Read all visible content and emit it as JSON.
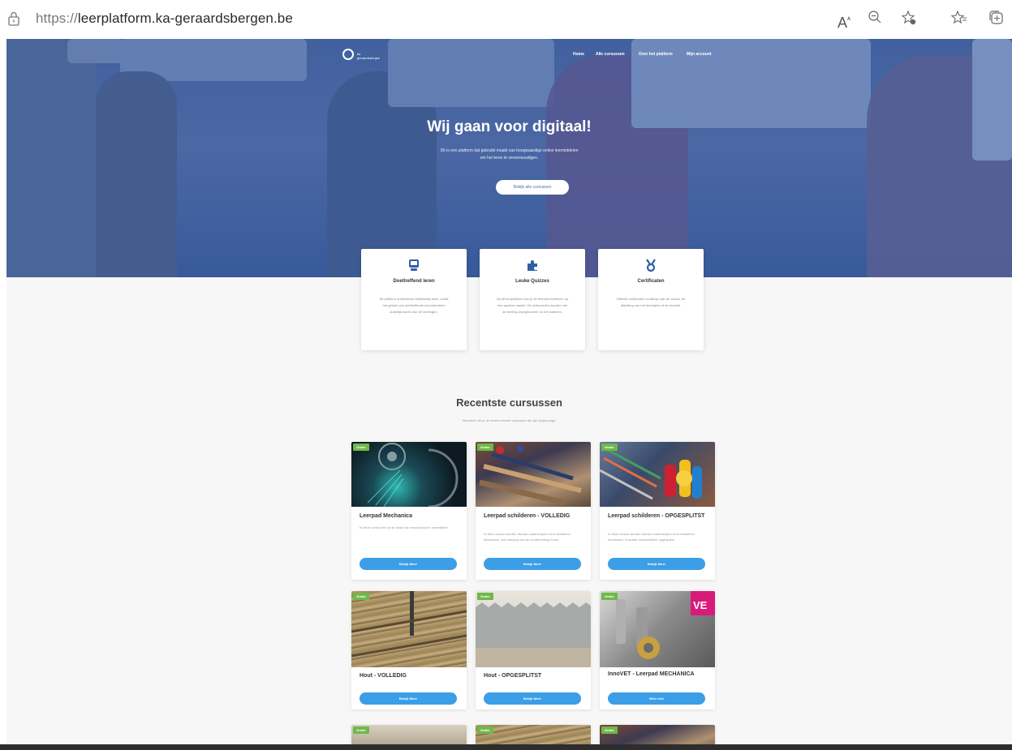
{
  "browser": {
    "url_prefix": "https://",
    "url_host": "leerplatform.ka-geraardsbergen.be",
    "icons": [
      "read-aloud-icon",
      "zoom-icon",
      "favorite-add-icon",
      "favorites-icon",
      "collections-icon"
    ]
  },
  "nav": {
    "logo_text": "ka\ngeraardsbergen",
    "items": [
      "Home",
      "Alle cursussen",
      "Over het platform",
      "Mijn account"
    ]
  },
  "hero": {
    "title": "Wij gaan voor digitaal!",
    "subtitle_line1": "Dit is een platform dat gebruikt maakt van hoogwaardige online leermiddelen",
    "subtitle_line2": "om het leren te vereenvoudigen.",
    "button": "Bekijk alle cursussen"
  },
  "features": [
    {
      "icon": "device-icon",
      "title": "Doeltreffend leren",
      "body": "Dit platform ondersteunt zelfstandig leren, zodat het geheel van doeltreffende lesonderdelen duidelijk wordt voor de leerlingen."
    },
    {
      "icon": "puzzle-icon",
      "title": "Leuke Quizzes",
      "body": "Op dit leerplatform kan je de leerstof inoefenen op een speelse manier. De antwoorden worden met de leerling doorgenomen na het indienen."
    },
    {
      "icon": "medal-icon",
      "title": "Certificaten",
      "body": "Officiële certificaten na afloop van de cursus, ter afsluiting van het leertraject of de module."
    }
  ],
  "section": {
    "title": "Recentste cursussen",
    "subtitle": "Hieronder zie je de meest recente cursussen die zijn toegevoegd."
  },
  "courses": [
    {
      "badge": "Gratis",
      "title": "Leerpad Mechanica",
      "desc": "In deze cursus leer je de basis van mechanica en onderdelen.",
      "button": "Bekijk Meer",
      "image": "laser-saw"
    },
    {
      "badge": "Gratis",
      "title": "Leerpad schilderen - VOLLEDIG",
      "desc": "In deze cursus worden diverse onderwerpen rond schilderen behandeld, met inbegrip van de voorbereiding ervan.",
      "button": "Bekijk Meer",
      "image": "paint-brushes"
    },
    {
      "badge": "Gratis",
      "title": "Leerpad schilderen - OPGESPLITST",
      "desc": "In deze cursus worden diverse onderwerpen rond schilderen behandeld, in aparte hoofdstukken opgesplitst.",
      "button": "Bekijk Meer",
      "image": "paint-bottles"
    },
    {
      "badge": "Gratis",
      "title": "Hout - VOLLEDIG",
      "desc": "",
      "button": "Bekijk Meer",
      "image": "wood-router"
    },
    {
      "badge": "Gratis",
      "title": "Hout - OPGESPLITST",
      "desc": "",
      "button": "Bekijk Meer",
      "image": "saw-blade"
    },
    {
      "badge": "Gratis",
      "title": "InnoVET - Leerpad MECHANICA",
      "desc": "",
      "button": "Meer Info",
      "image": "machine-parts"
    },
    {
      "badge": "Gratis",
      "title": "",
      "desc": "",
      "button": "",
      "image": "saw-blade-2"
    },
    {
      "badge": "Gratis",
      "title": "",
      "desc": "",
      "button": "",
      "image": "wood-router-2"
    },
    {
      "badge": "Gratis",
      "title": "",
      "desc": "",
      "button": "",
      "image": "paint-brushes-2"
    }
  ],
  "colors": {
    "hero_blue": "#4a6aa3",
    "accent_blue": "#3c9ee6",
    "badge_green": "#6fb84a"
  }
}
